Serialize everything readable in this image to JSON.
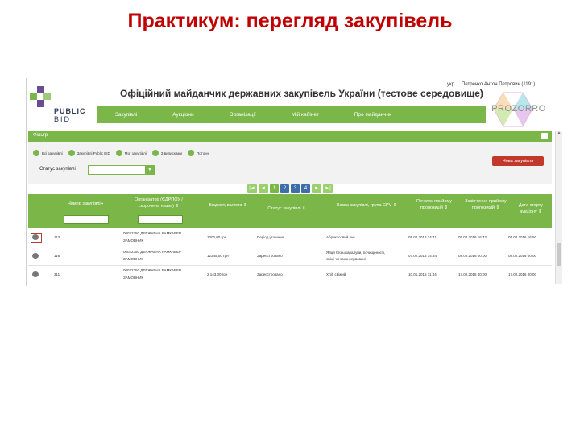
{
  "slide": {
    "title": "Практикум: перегляд закупівель"
  },
  "site": {
    "logo_line1": "PUBLIC",
    "logo_line2": "BID",
    "title": "Офіційний майданчик державних закупівель України (тестове середовище)",
    "lang": "укр",
    "user": "Петренко Антон Петрович (1191)",
    "prozorro": "PROZORRO"
  },
  "nav": {
    "items": [
      "Закупівлі",
      "Аукціони",
      "Організації",
      "Мій кабінет",
      "Про майданчик"
    ]
  },
  "filter": {
    "title": "Фільтр",
    "toggle": "−",
    "radios": [
      "Всі закупівлі",
      "Закупівлі Public BID",
      "Мої закупівлі",
      "З виписками",
      "Поточні"
    ],
    "status_label": "Статус закупівлі",
    "status_value": ""
  },
  "new_button": "Нова закупівля",
  "pager": {
    "prev2": "|◄",
    "prev": "◄",
    "pages": [
      "1",
      "2",
      "3",
      "4"
    ],
    "next": "►",
    "next2": "►|"
  },
  "table": {
    "headers": [
      "Номер закупівлі ⬩",
      "Організатор (ЄДРПОУ / скорочена назва) ⇕",
      "Бюджет, валюта ⇕",
      "Статус закупівлі ⇕",
      "Назва закупівлі, група CPV ⇕",
      "Початок прийому пропозицій ⇕",
      "Закінчення прийому пропозицій ⇕",
      "Дата старту аукціону ⇕"
    ],
    "rows": [
      {
        "num": "113",
        "org1": "00022350 ДЕРЖАВНА РАМКАБЕР",
        "org2": "ЗАМОВНИК",
        "budget": "1000,00 грн",
        "status": "Період уточнень",
        "name1": "Абрикосовий рис",
        "name2": "",
        "start": "05.02.2016 14:41",
        "end": "05.02.2016 16:42",
        "auction": "05.02.2016 16:50"
      },
      {
        "num": "116",
        "org1": "00022350 ДЕРЖАВНА РАМКАБЕР",
        "org2": "ЗАМОВНИК",
        "budget": "12345,00 грн",
        "status": "Зареєстровано",
        "name1": "Яйця без шкаралупи, почищеності,",
        "name2": "свіжі чи законсервовані",
        "start": "07.02.2016 14:34",
        "end": "08.02.2016 00:00",
        "auction": "08.02.2016 00:00"
      },
      {
        "num": "311",
        "org1": "00022350 ДЕРЖАВНА РАМКАБЕР",
        "org2": "ЗАМОВНИК",
        "budget": "2 143,00 грн",
        "status": "Зареєстровано",
        "name1": "Хліб свіжий",
        "name2": "",
        "start": "10.01.2016 11:04",
        "end": "17.02.2016 00:00",
        "auction": "17.02.2016 00:00"
      }
    ]
  },
  "colors": {
    "green": "#7ab648",
    "red": "#c0392b",
    "title_red": "#c00000",
    "page_blue": "#3d6ea8"
  }
}
